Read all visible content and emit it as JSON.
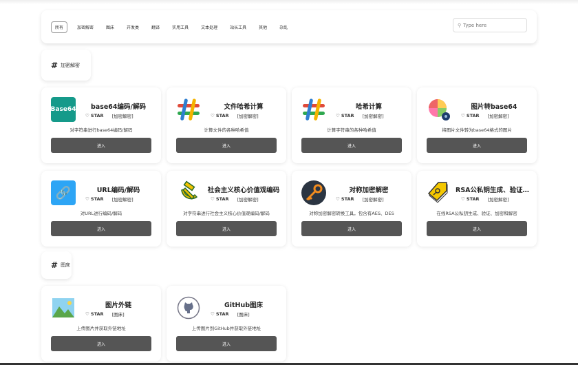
{
  "nav": {
    "items": [
      "所有",
      "加密解密",
      "图床",
      "开发类",
      "翻译",
      "实用工具",
      "文本处理",
      "站长工具",
      "其他",
      "杂乱"
    ],
    "active": 0,
    "search_placeholder": "Type here"
  },
  "sections": [
    {
      "title": "加密解密",
      "tools": [
        {
          "title": "base64编码/解码",
          "star": "STAR",
          "category": "[加密解密]",
          "desc": "对字符串进行base64编码/解码",
          "button": "进入",
          "icon": "base64-icon",
          "icon_text": "Base64"
        },
        {
          "title": "文件哈希计算",
          "star": "STAR",
          "category": "[加密解密]",
          "desc": "计算文件的各种哈希值",
          "button": "进入",
          "icon": "hash-icon"
        },
        {
          "title": "哈希计算",
          "star": "STAR",
          "category": "[加密解密]",
          "desc": "计算字符串的各种哈希值",
          "button": "进入",
          "icon": "hash-icon"
        },
        {
          "title": "图片转base64",
          "star": "STAR",
          "category": "[加密解密]",
          "desc": "将图片文件转为base64格式的图片",
          "button": "进入",
          "icon": "photos-icon"
        },
        {
          "title": "URL编码/解码",
          "star": "STAR",
          "category": "[加密解密]",
          "desc": "对URL进行编码/解码",
          "button": "进入",
          "icon": "link-icon"
        },
        {
          "title": "社会主义核心价值观编码",
          "star": "STAR",
          "category": "[加密解密]",
          "desc": "对字符串进行社会主义核心价值观编码/解码",
          "button": "进入",
          "icon": "hammer-sickle-icon"
        },
        {
          "title": "对称加密解密",
          "star": "STAR",
          "category": "[加密解密]",
          "desc": "对称加密解密转换工具，包含有AES、DES",
          "button": "进入",
          "icon": "key-icon"
        },
        {
          "title": "RSA公私钥生成、验证、加密",
          "star": "STAR",
          "category": "[加密解密]",
          "desc": "在线RSA公私钥生成、验证、加密和解密",
          "button": "进入",
          "icon": "key-tag-icon"
        }
      ]
    },
    {
      "title": "图床",
      "tools": [
        {
          "title": "图片外链",
          "star": "STAR",
          "category": "[图床]",
          "desc": "上传图片并获取外链地址",
          "button": "进入",
          "icon": "image-icon"
        },
        {
          "title": "GitHub图床",
          "star": "STAR",
          "category": "[图床]",
          "desc": "上传图片到GitHub并获取外链地址",
          "button": "进入",
          "icon": "github-icon"
        }
      ]
    }
  ]
}
